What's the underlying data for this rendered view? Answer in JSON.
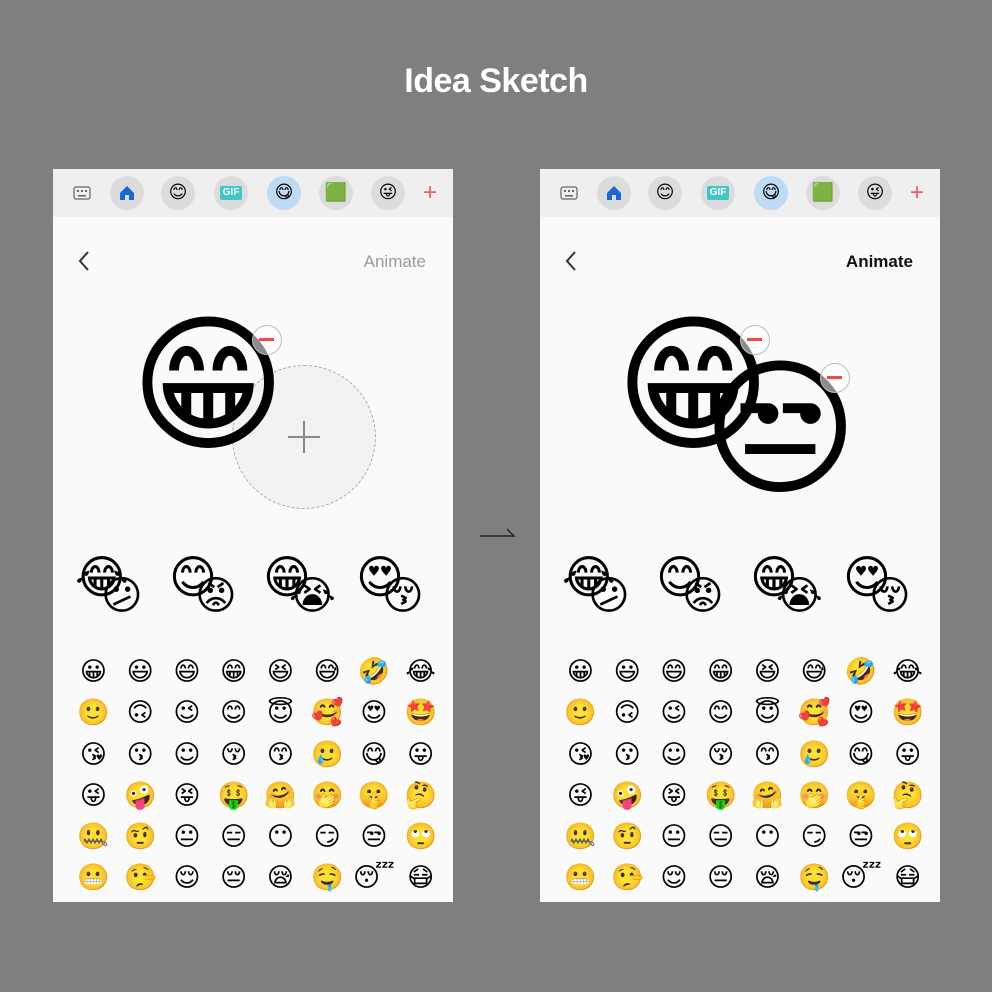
{
  "page_title": "Idea Sketch",
  "toolbar": {
    "tabs": [
      {
        "icon": "keyboard-icon",
        "glyph": "⌨"
      },
      {
        "icon": "home-icon",
        "glyph": "⌂"
      },
      {
        "icon": "emoji-icon",
        "glyph": "😊"
      },
      {
        "icon": "gif-icon",
        "label": "GIF"
      },
      {
        "icon": "mixed-emoji-icon",
        "glyph": "😋"
      },
      {
        "icon": "sticker-icon",
        "glyph": "🟩"
      },
      {
        "icon": "bitmoji-icon",
        "glyph": "😜"
      },
      {
        "icon": "add-icon",
        "glyph": "+"
      }
    ],
    "active_index": 4
  },
  "screens": {
    "left": {
      "animate_label": "Animate",
      "animate_enabled": false,
      "composer": {
        "primary": "😁",
        "secondary": null
      }
    },
    "right": {
      "animate_label": "Animate",
      "animate_enabled": true,
      "composer": {
        "primary": "😁",
        "secondary": "😒"
      }
    }
  },
  "suggestions": [
    {
      "a": "😂",
      "b": "😕"
    },
    {
      "a": "😊",
      "b": "😡"
    },
    {
      "a": "😁",
      "b": "😭"
    },
    {
      "a": "😍",
      "b": "😚"
    }
  ],
  "emoji_grid": [
    "😀",
    "😃",
    "😄",
    "😁",
    "😆",
    "😅",
    "🤣",
    "😂",
    "🙂",
    "🙃",
    "😉",
    "😊",
    "😇",
    "🥰",
    "😍",
    "🤩",
    "😘",
    "😗",
    "☺",
    "😚",
    "😙",
    "🥲",
    "😋",
    "😛",
    "😜",
    "🤪",
    "😝",
    "🤑",
    "🤗",
    "🤭",
    "🤫",
    "🤔",
    "🤐",
    "🤨",
    "😐",
    "😑",
    "😶",
    "😏",
    "😒",
    "🙄",
    "😬",
    "🤥",
    "😌",
    "😔",
    "😪",
    "🤤",
    "😴",
    "😷"
  ],
  "colors": {
    "background": "#7f7f7f",
    "panel": "#fafafa",
    "accent_active": "#bfdaf4",
    "remove": "#f04a42",
    "add": "#f25c63"
  }
}
